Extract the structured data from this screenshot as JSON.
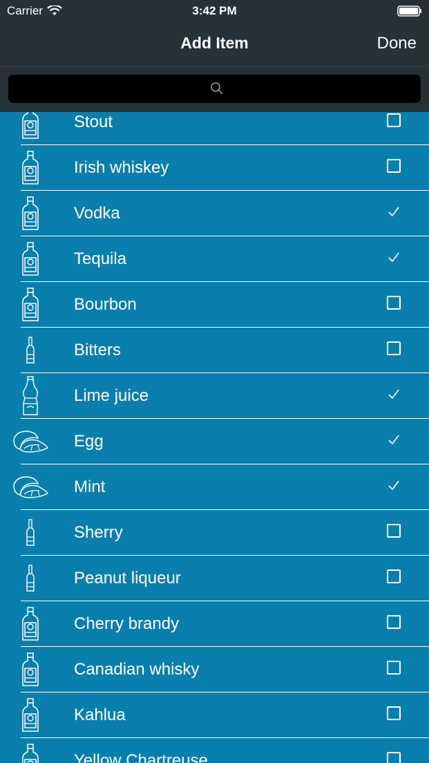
{
  "status_bar": {
    "carrier": "Carrier",
    "time": "3:42 PM"
  },
  "nav": {
    "title": "Add Item",
    "done_label": "Done"
  },
  "search": {
    "placeholder": ""
  },
  "items": [
    {
      "label": "Stout",
      "icon": "bottle-icon",
      "checked": false
    },
    {
      "label": "Irish whiskey",
      "icon": "bottle-icon",
      "checked": false
    },
    {
      "label": "Vodka",
      "icon": "bottle-icon",
      "checked": true
    },
    {
      "label": "Tequila",
      "icon": "bottle-icon",
      "checked": true
    },
    {
      "label": "Bourbon",
      "icon": "bottle-icon",
      "checked": false
    },
    {
      "label": "Bitters",
      "icon": "bitters-bottle-icon",
      "checked": false
    },
    {
      "label": "Lime juice",
      "icon": "soda-bottle-icon",
      "checked": true
    },
    {
      "label": "Egg",
      "icon": "lemon-slice-icon",
      "checked": true
    },
    {
      "label": "Mint",
      "icon": "lemon-slice-icon",
      "checked": true
    },
    {
      "label": "Sherry",
      "icon": "bitters-bottle-icon",
      "checked": false
    },
    {
      "label": "Peanut liqueur",
      "icon": "bitters-bottle-icon",
      "checked": false
    },
    {
      "label": "Cherry brandy",
      "icon": "bottle-icon",
      "checked": false
    },
    {
      "label": "Canadian whisky",
      "icon": "bottle-icon",
      "checked": false
    },
    {
      "label": "Kahlua",
      "icon": "bottle-icon",
      "checked": false
    },
    {
      "label": "Yellow Chartreuse",
      "icon": "bottle-icon",
      "checked": false
    }
  ],
  "colors": {
    "bar": "#263238",
    "list_bg": "#0a7fad",
    "search_field": "#000000",
    "text": "#ffffff"
  }
}
